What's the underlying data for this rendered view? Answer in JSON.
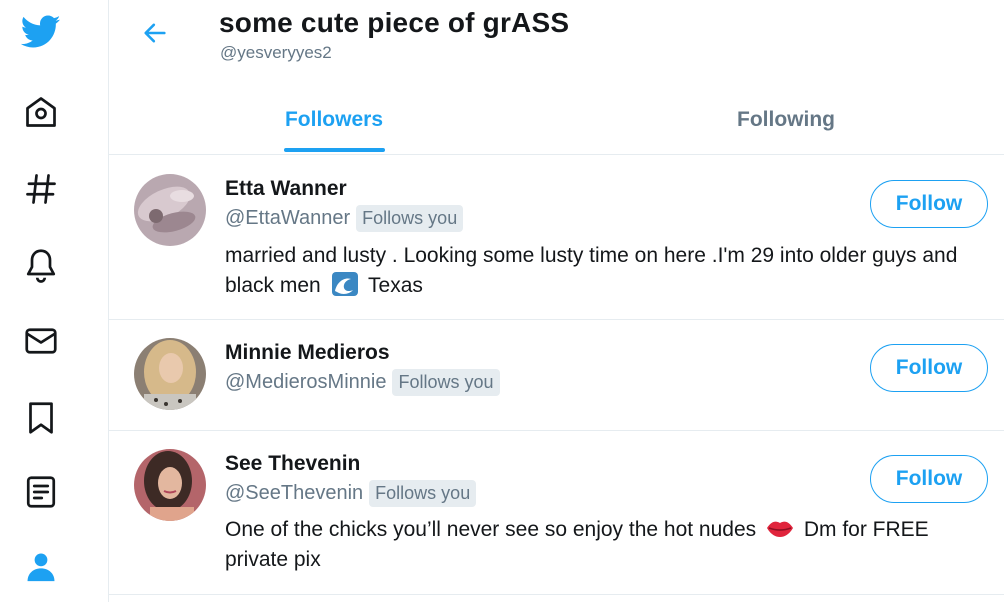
{
  "header": {
    "title": "some cute piece of grASS",
    "handle": "@yesveryyes2"
  },
  "tabs": [
    {
      "label": "Followers",
      "selected": true
    },
    {
      "label": "Following",
      "selected": false
    }
  ],
  "users": [
    {
      "name": "Etta Wanner",
      "handle": "@EttaWanner",
      "badge": "Follows you",
      "bio_before": "married and lusty . Looking some lusty time on here .I'm 29 into older guys and black men",
      "bio_emoji": "wave-emoji",
      "bio_after": "Texas",
      "button": "Follow"
    },
    {
      "name": "Minnie Medieros",
      "handle": "@MedierosMinnie",
      "badge": "Follows you",
      "button": "Follow"
    },
    {
      "name": "See Thevenin",
      "handle": "@SeeThevenin",
      "badge": "Follows you",
      "bio_before": "One of the chicks you’ll never see so enjoy the hot nudes",
      "bio_emoji": "lips-emoji",
      "bio_after": "Dm for FREE private pix",
      "button": "Follow"
    }
  ],
  "colors": {
    "accent": "#1da1f2",
    "secondary_text": "#657786",
    "border": "#e6ecf0",
    "primary_text": "#14171a"
  },
  "nav_icons": [
    "twitter-logo-icon",
    "home-icon",
    "explore-hashtag-icon",
    "notifications-bell-icon",
    "messages-envelope-icon",
    "bookmarks-icon",
    "lists-icon",
    "profile-icon"
  ]
}
